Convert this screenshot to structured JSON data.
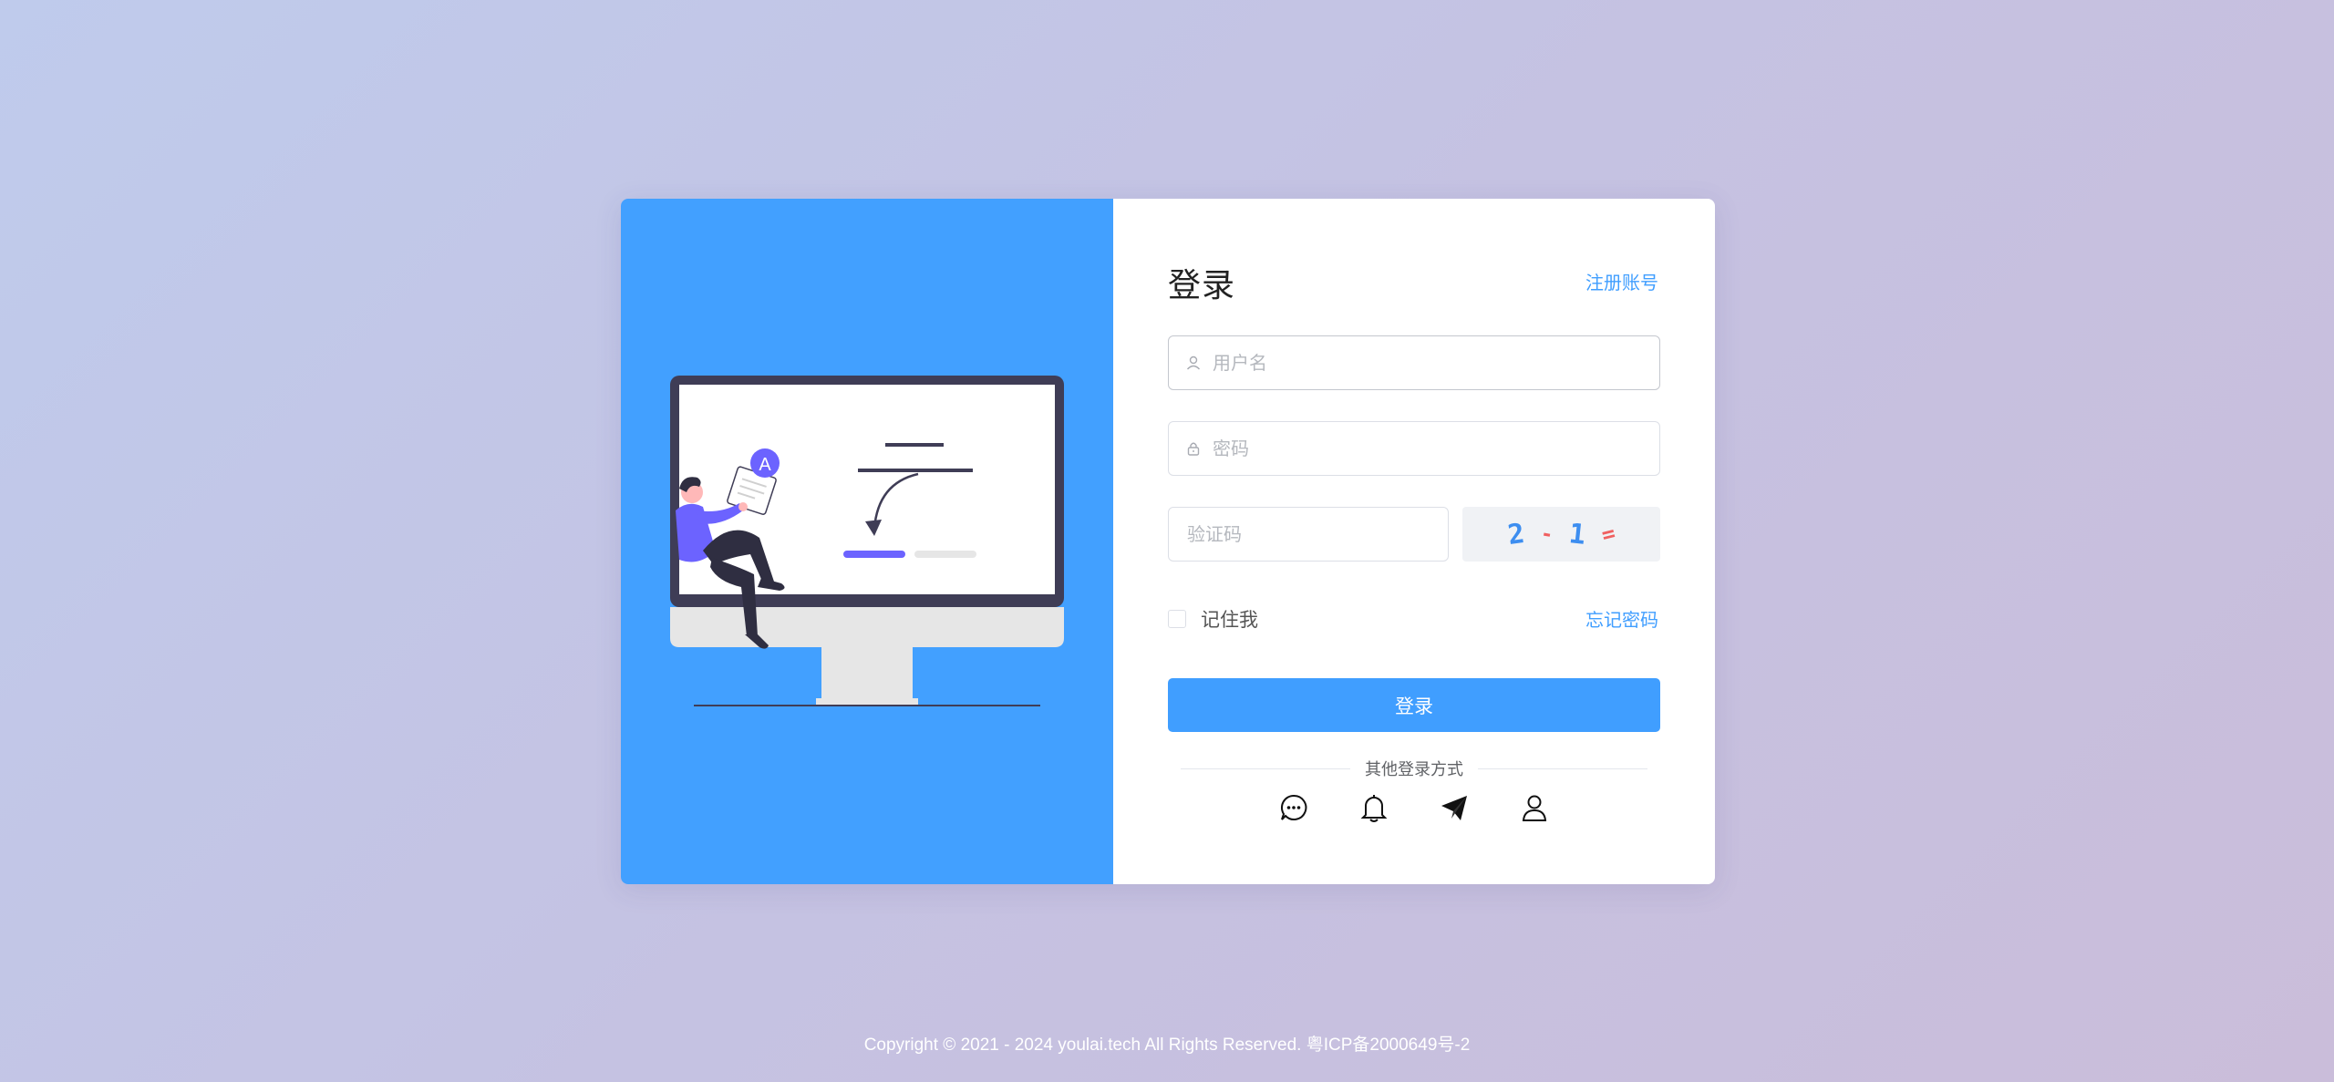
{
  "login": {
    "title": "登录",
    "register_link": "注册账号",
    "username_placeholder": "用户名",
    "password_placeholder": "密码",
    "captcha_placeholder": "验证码",
    "captcha": [
      "2",
      "-",
      "1",
      "="
    ],
    "remember_label": "记住我",
    "forgot_link": "忘记密码",
    "submit_label": "登录",
    "other_methods_label": "其他登录方式",
    "social_icons": [
      "chat-icon",
      "bell-icon",
      "send-icon",
      "user-icon"
    ]
  },
  "illustration": {
    "badge_letter": "A"
  },
  "footer": {
    "copyright": "Copyright © 2021 - 2024 youlai.tech All Rights Reserved. 粤ICP备2000649号-2"
  },
  "colors": {
    "accent": "#409eff",
    "panel_blue": "#42a0ff",
    "figure_purple": "#6c63ff"
  }
}
